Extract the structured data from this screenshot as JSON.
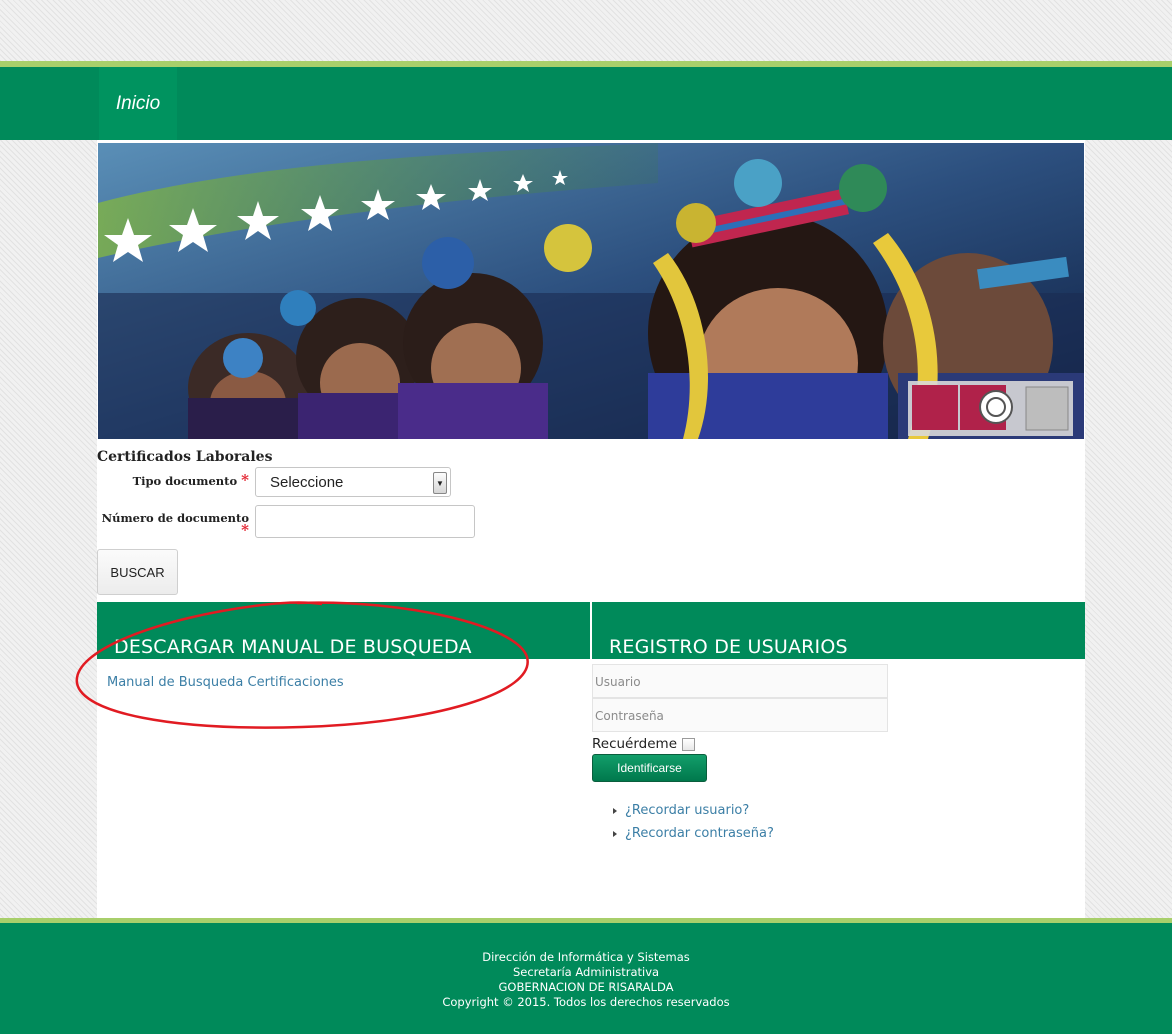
{
  "nav": {
    "home_label": "Inicio"
  },
  "form": {
    "title": "Certificados Laborales",
    "doc_type_label": "Tipo documento",
    "doc_type_value": "Seleccione",
    "doc_number_label_line1": "Número de",
    "doc_number_label_line2": "documento",
    "required_mark": "*",
    "search_button": "BUSCAR"
  },
  "manual_section": {
    "title": "DESCARGAR MANUAL DE BUSQUEDA",
    "link_text": "Manual de Busqueda Certificaciones"
  },
  "login_section": {
    "title": "REGISTRO DE USUARIOS",
    "username_placeholder": "Usuario",
    "password_placeholder": "Contraseña",
    "remember_label": "Recuérdeme",
    "login_button": "Identificarse",
    "recover_links": [
      "¿Recordar usuario?",
      "¿Recordar contraseña?"
    ]
  },
  "footer": {
    "lines": [
      "Dirección de Informática y Sistemas",
      "Secretaría Administrativa",
      "GOBERNACION DE RISARALDA",
      "Copyright © 2015. Todos los derechos reservados"
    ]
  },
  "colors": {
    "brand_green": "#008a5a",
    "accent_lime": "#a8cf6b",
    "link_blue": "#3c7fa6",
    "annotation_red": "#e11b22"
  },
  "icons": [
    "dropdown-arrow-icon",
    "bullet-arrow-icon",
    "iso-certification-badge"
  ]
}
